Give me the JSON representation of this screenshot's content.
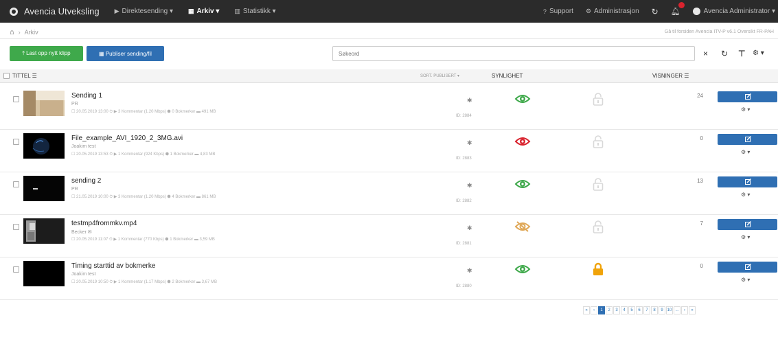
{
  "navbar": {
    "brand": "Avencia Utveksling",
    "items": [
      {
        "icon": "video-icon",
        "glyph": "▶",
        "label": "Direktesending ▾",
        "active": false
      },
      {
        "icon": "archive-icon",
        "glyph": "▦",
        "label": "Arkiv ▾",
        "active": true
      },
      {
        "icon": "statistics-icon",
        "glyph": "▥",
        "label": "Statistikk ▾",
        "active": false
      }
    ],
    "support": "Support",
    "admin": "Administrasjon",
    "user": "Avencia Administrator ▾"
  },
  "breadcrumb": {
    "home_glyph": "⌂",
    "items": [
      "Arkiv"
    ],
    "server_info": "Gå til forsiden  Avencia ITV-P v6.1  Oversikt  FR-PAH"
  },
  "toolbar": {
    "upload_label": "⤒ Last opp nytt klipp",
    "publish_label": "▦ Publiser sending/fil",
    "search_placeholder": "Søkeord",
    "clear": "×",
    "refresh": "↻",
    "filter": "⊤",
    "settings": "⚙ ▾"
  },
  "table": {
    "headers": {
      "title": "TITTEL ☰",
      "published": "SORT. PUBLISERT ▾",
      "visibility": "SYNLIGHET",
      "views": "VISNINGER ☰"
    },
    "colors": {
      "visible": "#3fa94b",
      "hidden": "#d9232e",
      "scheduled": "#e0a95a",
      "locked": "#f0a30a",
      "unlocked": "#d9d9d9"
    },
    "rows": [
      {
        "title": "Sending 1",
        "subtitle": "PR",
        "meta": "☐ 20.05.2019 13:00  ⏱ ▶ 3 Kommentar  (1.20 Mbps)  ⬢ 0 Bokmerker  ▬ 491 MB",
        "thumb": "hall",
        "id": "ID: 2884",
        "visibility": "visible",
        "locked": false,
        "views": "24"
      },
      {
        "title": "File_example_AVI_1920_2_3MG.avi",
        "subtitle": "Joakim test",
        "meta": "☐ 20.05.2019 13:53  ⏱ ▶ 1 Kommentar  (924 Kbps)  ⬢ 1 Bokmerker  ▬ 4,83 MB",
        "thumb": "planet",
        "id": "ID: 2883",
        "visibility": "hidden",
        "locked": false,
        "views": "0"
      },
      {
        "title": "sending 2",
        "subtitle": "PR",
        "meta": "☐ 21.05.2019 10:00  ⏱ ▶ 3 Kommentar  (1.20 Mbps)  ⬢ 4 Bokmerker  ▬ 861 MB",
        "thumb": "dark-line",
        "id": "ID: 2882",
        "visibility": "visible",
        "locked": false,
        "views": "13"
      },
      {
        "title": "testmp4frommkv.mp4",
        "subtitle": "Becker ✉",
        "meta": "☐ 20.05.2019 11:07  ⏱ ▶ 1 Kommentar  (770 Kbps)  ⬢ 1 Bokmerker  ▬ 3,59 MB",
        "thumb": "figure",
        "id": "ID: 2881",
        "visibility": "scheduled",
        "locked": false,
        "views": "7"
      },
      {
        "title": "Timing starttid av bokmerke",
        "subtitle": "Joakim test",
        "meta": "☐ 20.05.2019 10:50  ⏱ ▶ 1 Kommentar  (1.17 Mbps)  ⬢ 2 Bokmerker  ▬ 3,67 MB",
        "thumb": "black",
        "id": "ID: 2880",
        "visibility": "visible",
        "locked": true,
        "views": "0"
      }
    ],
    "row_settings": "⚙ ▾",
    "star": "✱"
  },
  "pagination": {
    "items": [
      "«",
      "‹",
      "1",
      "2",
      "3",
      "4",
      "5",
      "6",
      "7",
      "8",
      "9",
      "10",
      "...",
      "›",
      "»"
    ],
    "active": "1"
  }
}
